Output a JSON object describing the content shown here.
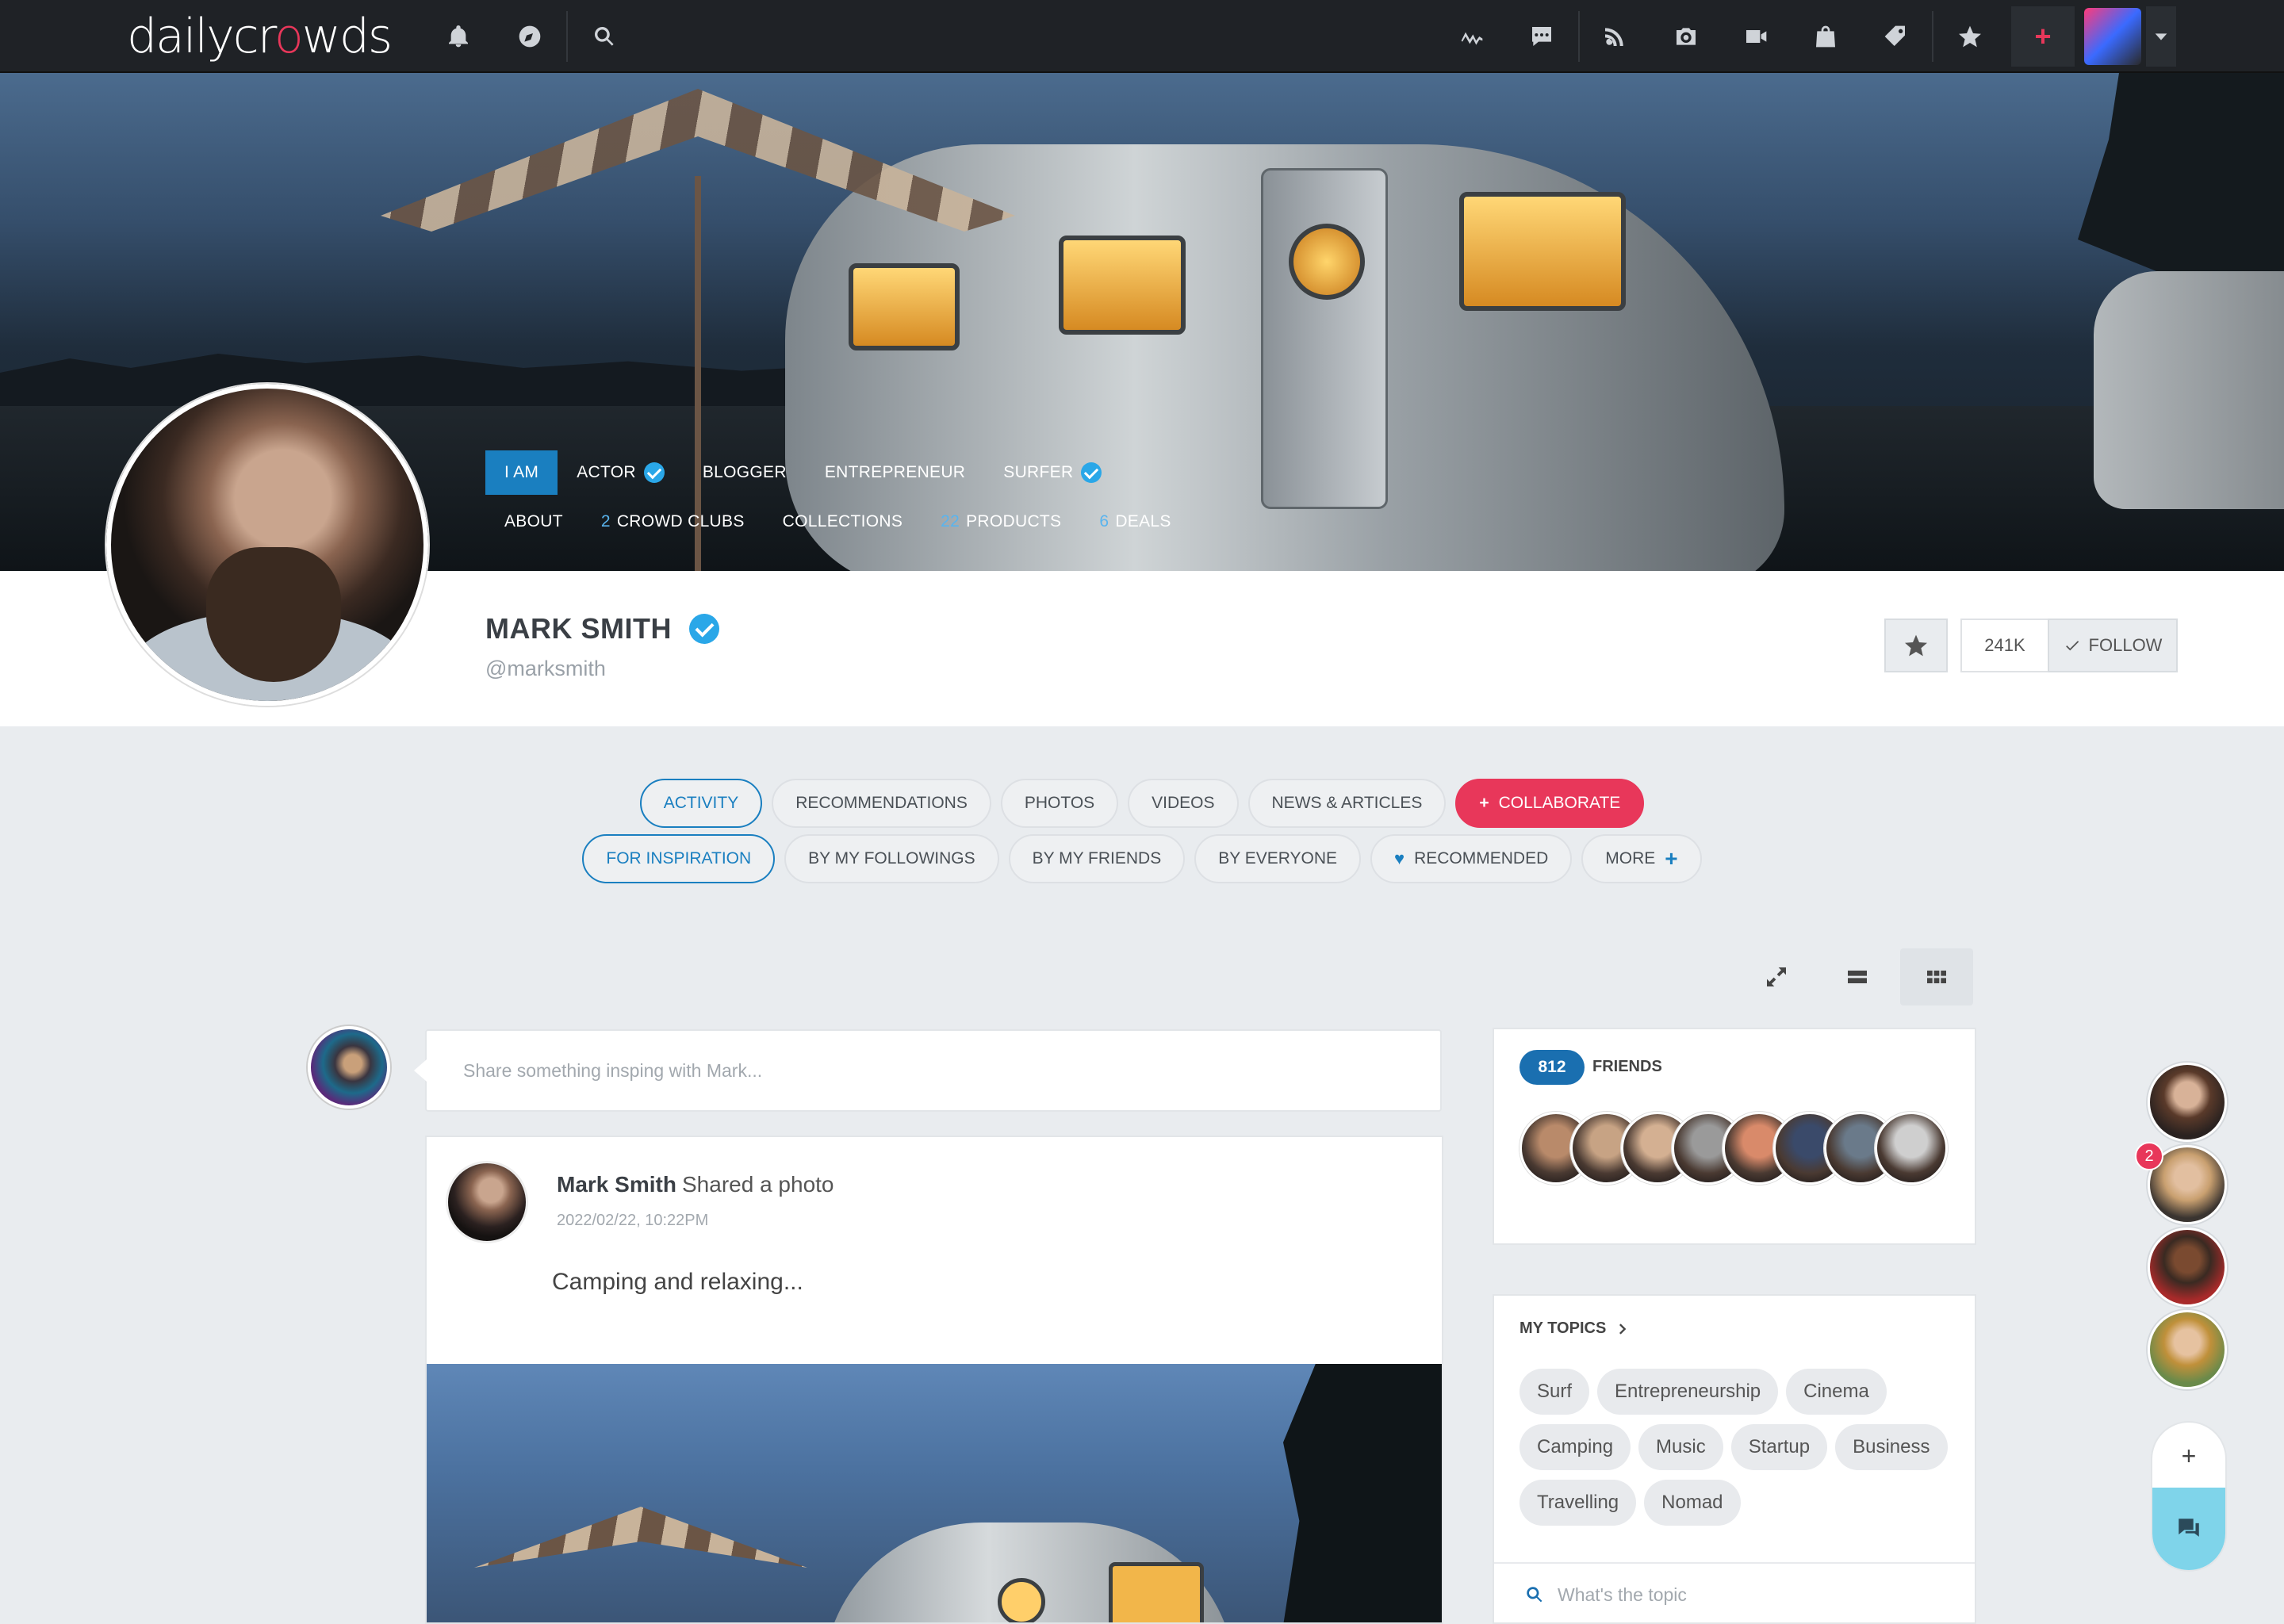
{
  "app": {
    "logo_pre": "dailycr",
    "logo_o": "o",
    "logo_post": "wds"
  },
  "topbar": {
    "left_icons": [
      "bell-icon",
      "compass-icon",
      "search-icon"
    ],
    "right_icons": [
      "activity-icon",
      "chat-icon",
      "rss-icon",
      "camera-icon",
      "video-icon",
      "bag-icon",
      "tag-icon",
      "star-icon"
    ],
    "plus": "+"
  },
  "profile": {
    "name": "MARK SMITH",
    "handle": "@marksmith",
    "roles": [
      {
        "label": "I AM",
        "active": true,
        "verified": false
      },
      {
        "label": "ACTOR",
        "active": false,
        "verified": true
      },
      {
        "label": "BLOGGER",
        "active": false,
        "verified": false
      },
      {
        "label": "ENTREPRENEUR",
        "active": false,
        "verified": false
      },
      {
        "label": "SURFER",
        "active": false,
        "verified": true
      }
    ],
    "links": [
      {
        "count": "",
        "label": "ABOUT"
      },
      {
        "count": "2",
        "label": "CROWD CLUBS"
      },
      {
        "count": "",
        "label": "COLLECTIONS"
      },
      {
        "count": "22",
        "label": "PRODUCTS"
      },
      {
        "count": "6",
        "label": "DEALS"
      }
    ],
    "followers": "241K",
    "follow_label": "FOLLOW"
  },
  "tabs_primary": [
    {
      "label": "ACTIVITY",
      "state": "selected"
    },
    {
      "label": "RECOMMENDATIONS",
      "state": ""
    },
    {
      "label": "PHOTOS",
      "state": ""
    },
    {
      "label": "VIDEOS",
      "state": ""
    },
    {
      "label": "NEWS & ARTICLES",
      "state": ""
    },
    {
      "label": "COLLABORATE",
      "state": "red"
    }
  ],
  "tabs_secondary": [
    {
      "label": "FOR INSPIRATION",
      "state": "selected"
    },
    {
      "label": "BY MY FOLLOWINGS",
      "state": ""
    },
    {
      "label": "BY MY FRIENDS",
      "state": ""
    },
    {
      "label": "BY EVERYONE",
      "state": ""
    },
    {
      "label": "RECOMMENDED",
      "state": "heart"
    },
    {
      "label": "MORE",
      "state": "more"
    }
  ],
  "composer": {
    "placeholder": "Share something insping with Mark..."
  },
  "post": {
    "author": "Mark Smith",
    "action": "Shared a photo",
    "time": "2022/02/22, 10:22PM",
    "text": "Camping and relaxing..."
  },
  "friends": {
    "count": "812",
    "label": "FRIENDS",
    "face_colors": [
      "#b98a6a",
      "#c7a384",
      "#d4b092",
      "#9a9a9a",
      "#d98a6a",
      "#3a4a6a",
      "#6a7a8a",
      "#cfcfcf"
    ]
  },
  "topics": {
    "title": "MY TOPICS",
    "chips": [
      "Surf",
      "Entrepreneurship",
      "Cinema",
      "Camping",
      "Music",
      "Startup",
      "Business",
      "Travelling",
      "Nomad"
    ],
    "search_placeholder": "What's the topic"
  },
  "sidebar_people": {
    "badge": "2",
    "plus": "+"
  }
}
